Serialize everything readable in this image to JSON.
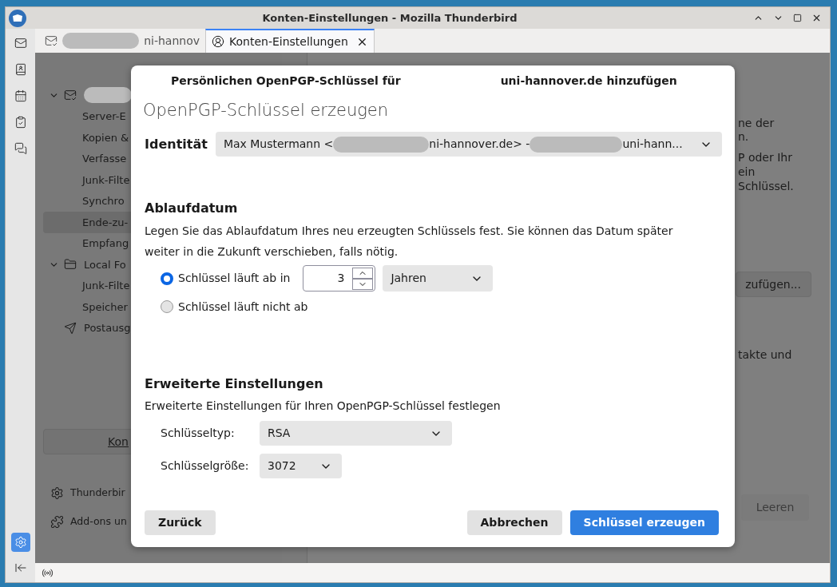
{
  "window": {
    "title": "Konten-Einstellungen - Mozilla Thunderbird"
  },
  "spaces_bar": {
    "items": [
      {
        "kind": "mail",
        "selected": false
      },
      {
        "kind": "address-book",
        "selected": false
      },
      {
        "kind": "calendar",
        "selected": false
      },
      {
        "kind": "tasks",
        "selected": false
      },
      {
        "kind": "chat",
        "selected": false
      }
    ],
    "bottom_items": [
      {
        "kind": "settings",
        "selected": true
      },
      {
        "kind": "collapse",
        "selected": false
      }
    ]
  },
  "tabs": [
    {
      "label": "ni-hannov",
      "kind": "mail",
      "redacted": true,
      "selected": false,
      "closable": false
    },
    {
      "label": "Konten-Einstellungen",
      "kind": "account",
      "redacted": false,
      "selected": true,
      "closable": true
    }
  ],
  "account_tree": [
    {
      "kind": "account",
      "redacted": true,
      "expanded": true,
      "children": [
        {
          "label": "Server-E",
          "selected": false
        },
        {
          "label": "Kopien &",
          "selected": false
        },
        {
          "label": "Verfasse",
          "selected": false
        },
        {
          "label": "Junk-Filte",
          "selected": false
        },
        {
          "label": "Synchro",
          "selected": false
        },
        {
          "label": "Ende-zu-",
          "selected": true
        },
        {
          "label": "Empfang",
          "selected": false
        }
      ]
    },
    {
      "kind": "folder",
      "label": "Local Fo",
      "expanded": true,
      "children": [
        {
          "label": "Junk-Filte",
          "selected": false
        },
        {
          "label": "Speicher",
          "selected": false
        }
      ]
    },
    {
      "kind": "outbox",
      "label": "Postausg",
      "expanded": false
    }
  ],
  "account_actions_button": "Kon",
  "bottom_links": [
    {
      "kind": "settings",
      "label": "Thunderbir"
    },
    {
      "kind": "addons",
      "label": "Add-ons un"
    }
  ],
  "right_pane": {
    "paragraph_1": [
      "ne der",
      "n."
    ],
    "paragraph_2": [
      "P oder Ihr",
      "ein",
      "Schlüssel."
    ],
    "add_button": "zufügen...",
    "paragraph_3": "takte und",
    "clear_button": {
      "label": "Leeren",
      "disabled": true
    }
  },
  "dialog": {
    "heading_parts": [
      "Persönlichen OpenPGP-Schlüssel für",
      "uni-hannover.de hinzufügen"
    ],
    "title": "OpenPGP-Schlüssel erzeugen",
    "identity": {
      "label": "Identität",
      "value_parts": [
        "Max Mustermann <",
        "ni-hannover.de> -",
        "uni-hann..."
      ]
    },
    "expiry": {
      "heading": "Ablaufdatum",
      "description": "Legen Sie das Ablaufdatum Ihres neu erzeugten Schlüssels fest. Sie können das Datum später weiter in die Zukunft verschieben, falls nötig.",
      "options": [
        {
          "label": "Schlüssel läuft ab in",
          "selected": true
        },
        {
          "label": "Schlüssel läuft nicht ab",
          "selected": false
        }
      ],
      "amount": "3",
      "unit": "Jahren"
    },
    "advanced": {
      "heading": "Erweiterte Einstellungen",
      "description": "Erweiterte Einstellungen für Ihren OpenPGP-Schlüssel festlegen",
      "fields": [
        {
          "label": "Schlüsseltyp:",
          "value": "RSA",
          "kind": "wide"
        },
        {
          "label": "Schlüsselgröße:",
          "value": "3072",
          "kind": "narrow"
        }
      ]
    },
    "buttons": [
      {
        "label": "Zurück",
        "kind": "back"
      },
      {
        "label": "Abbrechen",
        "kind": "cancel"
      },
      {
        "label": "Schlüssel erzeugen",
        "kind": "primary"
      }
    ]
  }
}
